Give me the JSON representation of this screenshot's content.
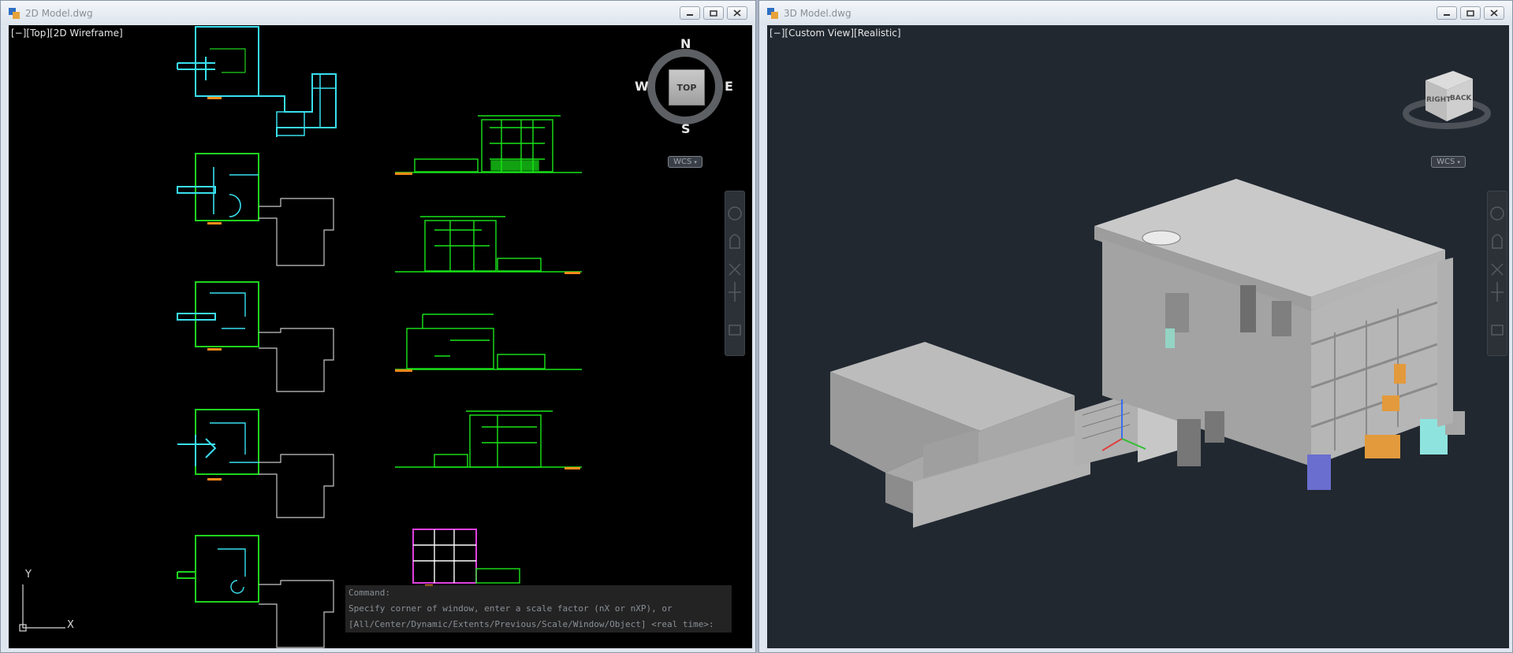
{
  "left_window": {
    "title": "2D Model.dwg",
    "view_label": "[−][Top][2D Wireframe]",
    "compass": {
      "n": "N",
      "s": "S",
      "e": "E",
      "w": "W",
      "center": "TOP"
    },
    "wcs": "WCS",
    "ucs": {
      "x": "X",
      "y": "Y"
    },
    "command_lines": [
      "Command:",
      "Specify corner of window, enter a scale factor (nX or nXP), or",
      "[All/Center/Dynamic/Extents/Previous/Scale/Window/Object] <real time>:"
    ]
  },
  "right_window": {
    "title": "3D Model.dwg",
    "view_label": "[−][Custom View][Realistic]",
    "viewcube": {
      "right": "RIGHT",
      "back": "BACK"
    },
    "wcs": "WCS"
  },
  "colors": {
    "plan_cyan": "#39e0f0",
    "plan_green": "#1fd31f",
    "elev_green": "#19e619",
    "magenta": "#e040e0",
    "orange": "#ff8c1a",
    "outline_white": "#c8c8c8"
  }
}
